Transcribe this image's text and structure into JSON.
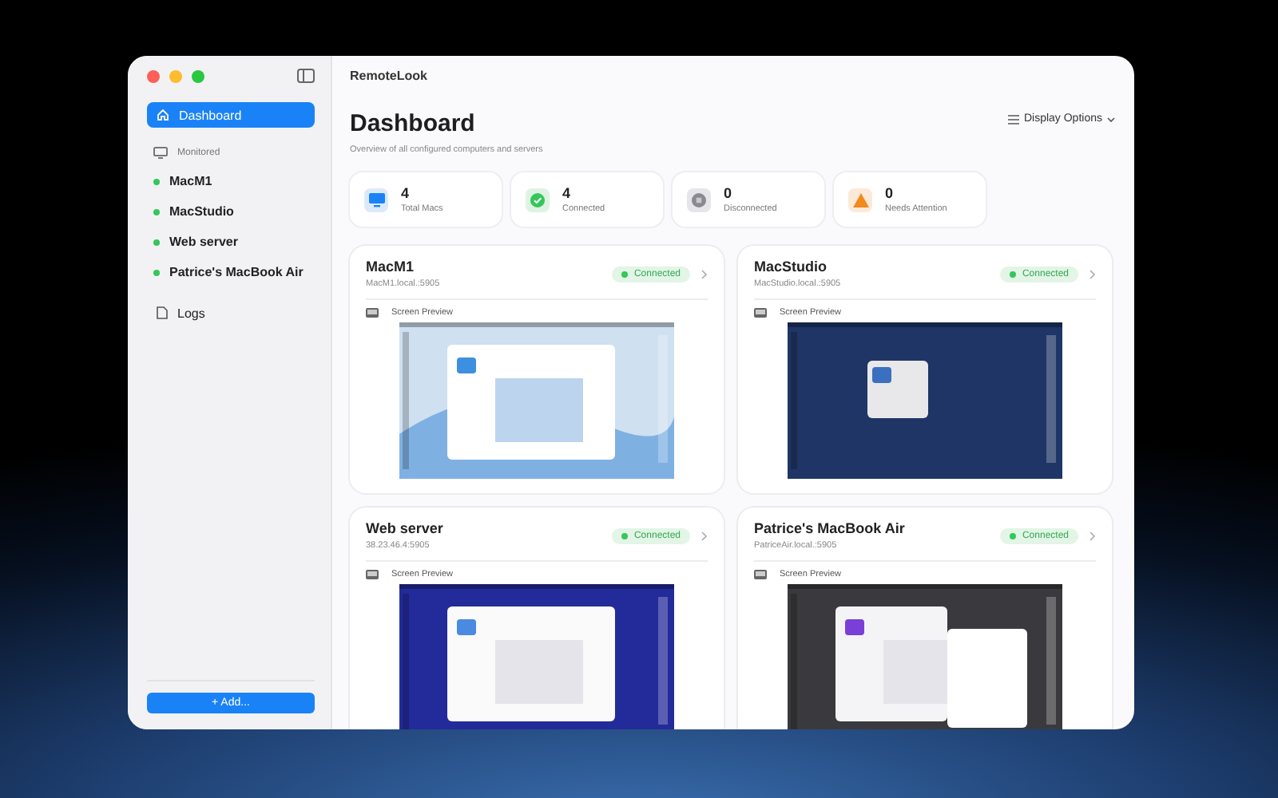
{
  "window": {
    "title": "RemoteLook"
  },
  "sidebar": {
    "items": [
      {
        "label": "Dashboard",
        "kind": "nav",
        "selected": true
      }
    ],
    "section": {
      "label": "Monitored",
      "items": [
        {
          "label": "MacM1",
          "color": "#34c759",
          "selected": false
        },
        {
          "label": "MacStudio",
          "color": "#34c759",
          "selected": false
        },
        {
          "label": "Web server",
          "color": "#34c759",
          "selected": false
        },
        {
          "label": "Patrice's MacBook Air",
          "color": "#34c759",
          "selected": false
        }
      ]
    },
    "footer_items": [
      {
        "label": "Logs",
        "kind": "logs",
        "selected": false
      }
    ],
    "add_button": "+ Add..."
  },
  "header": {
    "title": "Dashboard",
    "subtitle": "Overview of all configured computers and servers",
    "display_options": "Display Options"
  },
  "stats": [
    {
      "kind": "total",
      "value": "4",
      "label": "Total Macs"
    },
    {
      "kind": "connected",
      "value": "4",
      "label": "Connected"
    },
    {
      "kind": "disconnected",
      "value": "0",
      "label": "Disconnected"
    },
    {
      "kind": "attention",
      "value": "0",
      "label": "Needs Attention"
    }
  ],
  "machines": [
    {
      "name": "MacM1",
      "address": "MacM1.local.:5905",
      "status": "Connected",
      "connected": true,
      "preview_label": "Screen Preview",
      "kind": "light"
    },
    {
      "name": "MacStudio",
      "address": "MacStudio.local.:5905",
      "status": "Connected",
      "connected": true,
      "preview_label": "Screen Preview",
      "kind": "navy"
    },
    {
      "name": "Web server",
      "address": "38.23.46.4:5905",
      "status": "Connected",
      "connected": true,
      "preview_label": "Screen Preview",
      "kind": "blue"
    },
    {
      "name": "Patrice's MacBook Air",
      "address": "PatriceAir.local.:5905",
      "status": "Connected",
      "connected": true,
      "preview_label": "Screen Preview",
      "kind": "dark"
    }
  ]
}
